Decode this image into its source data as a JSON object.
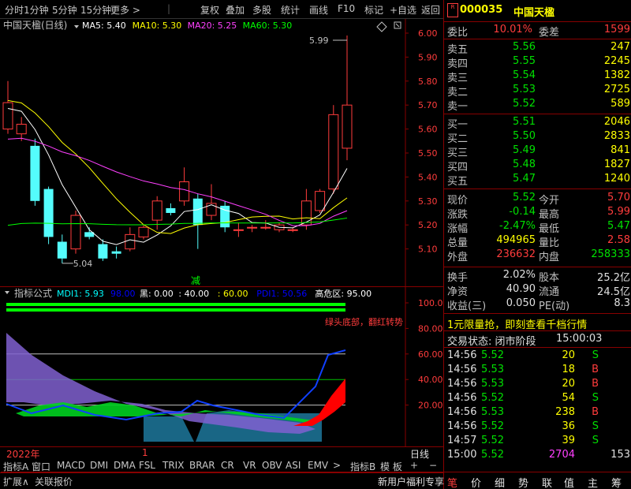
{
  "toolbar": {
    "items": [
      "分时",
      "1分钟",
      "5分钟",
      "15分钟",
      "更多 >",
      "复权",
      "叠加",
      "多股",
      "统计",
      "画线",
      "F10",
      "标记",
      "+自选",
      "返回"
    ]
  },
  "chart": {
    "title": "中国天楹(日线)",
    "ma_labels": [
      {
        "text": "MA5: 5.40",
        "color": "#ffffff"
      },
      {
        "text": "MA10: 5.30",
        "color": "#ffff00"
      },
      {
        "text": "MA20: 5.25",
        "color": "#ff40ff"
      },
      {
        "text": "MA60: 5.30",
        "color": "#00ff00"
      }
    ],
    "high_label": "5.99",
    "low_label": "5.04",
    "marker_text": "减",
    "y_ticks": [
      "6.00",
      "5.90",
      "5.80",
      "5.70",
      "5.60",
      "5.50",
      "5.40",
      "5.30",
      "5.20",
      "5.10"
    ],
    "candles": [
      {
        "o": 5.6,
        "c": 5.71,
        "h": 5.8,
        "l": 5.58
      },
      {
        "o": 5.58,
        "c": 5.62,
        "h": 5.65,
        "l": 5.55
      },
      {
        "o": 5.53,
        "c": 5.3,
        "h": 5.56,
        "l": 5.28
      },
      {
        "o": 5.35,
        "c": 5.15,
        "h": 5.36,
        "l": 5.12
      },
      {
        "o": 5.13,
        "c": 5.06,
        "h": 5.16,
        "l": 5.04
      },
      {
        "o": 5.1,
        "c": 5.24,
        "h": 5.26,
        "l": 5.08
      },
      {
        "o": 5.17,
        "c": 5.15,
        "h": 5.19,
        "l": 5.14
      },
      {
        "o": 5.12,
        "c": 5.06,
        "h": 5.14,
        "l": 5.05
      },
      {
        "o": 5.09,
        "c": 5.08,
        "h": 5.11,
        "l": 5.06
      },
      {
        "o": 5.1,
        "c": 5.16,
        "h": 5.19,
        "l": 5.09
      },
      {
        "o": 5.15,
        "c": 5.19,
        "h": 5.2,
        "l": 5.14
      },
      {
        "o": 5.22,
        "c": 5.3,
        "h": 5.32,
        "l": 5.18
      },
      {
        "o": 5.27,
        "c": 5.25,
        "h": 5.29,
        "l": 5.24
      },
      {
        "o": 5.3,
        "c": 5.38,
        "h": 5.44,
        "l": 5.28
      },
      {
        "o": 5.31,
        "c": 5.2,
        "h": 5.33,
        "l": 5.1
      },
      {
        "o": 5.24,
        "c": 5.29,
        "h": 5.37,
        "l": 5.22
      },
      {
        "o": 5.28,
        "c": 5.19,
        "h": 5.3,
        "l": 5.17
      },
      {
        "o": 5.18,
        "c": 5.18,
        "h": 5.21,
        "l": 5.15
      },
      {
        "o": 5.19,
        "c": 5.19,
        "h": 5.2,
        "l": 5.17
      },
      {
        "o": 5.19,
        "c": 5.19,
        "h": 5.22,
        "l": 5.18
      },
      {
        "o": 5.18,
        "c": 5.2,
        "h": 5.21,
        "l": 5.17
      },
      {
        "o": 5.18,
        "c": 5.18,
        "h": 5.19,
        "l": 5.17
      },
      {
        "o": 5.2,
        "c": 5.3,
        "h": 5.35,
        "l": 5.18
      },
      {
        "o": 5.26,
        "c": 5.34,
        "h": 5.35,
        "l": 5.25
      },
      {
        "o": 5.35,
        "c": 5.66,
        "h": 5.7,
        "l": 5.33
      },
      {
        "o": 5.52,
        "c": 5.7,
        "h": 5.99,
        "l": 5.47
      }
    ]
  },
  "indicator": {
    "title": "指标公式",
    "labels": [
      {
        "text": "MDI1: 5.93",
        "color": "#00ffff"
      },
      {
        "text": "98.00",
        "color": "#0000ff"
      },
      {
        "text": "黑: 0.00",
        "color": "#ffffff"
      },
      {
        "text": ": 40.00",
        "color": "#ffffff"
      },
      {
        "text": ": 60.00",
        "color": "#ffff00"
      },
      {
        "text": "PDI1: 50.56",
        "color": "#0000ff"
      },
      {
        "text": "高危区: 95.00",
        "color": "#ffffff"
      }
    ],
    "signal_text": "绿头底部，翻红转势",
    "y_ticks": [
      "100.0",
      "80.00",
      "60.00",
      "40.00",
      "20.00"
    ]
  },
  "bottom": {
    "year_label": "2022年",
    "date_label": "1",
    "period_label": "日线",
    "tabs": [
      "指标A",
      "窗口",
      "MACD",
      "DMI",
      "DMA",
      "FSL",
      "TRIX",
      "BRAR",
      "CR",
      "VR",
      "OBV",
      "ASI",
      "EMV",
      ">"
    ],
    "right_tabs": [
      "指标B",
      "模 板",
      "+",
      "−"
    ],
    "footer_left": [
      "扩展∧",
      "关联报价"
    ]
  },
  "quote": {
    "code": "000035",
    "name": "中国天楹",
    "weibi_label": "委比",
    "weibi_value": "10.01%",
    "weicha_label": "委差",
    "weicha_value": "1599",
    "asks": [
      {
        "label": "卖五",
        "price": "5.56",
        "vol": "247"
      },
      {
        "label": "卖四",
        "price": "5.55",
        "vol": "2245"
      },
      {
        "label": "卖三",
        "price": "5.54",
        "vol": "1382"
      },
      {
        "label": "卖二",
        "price": "5.53",
        "vol": "2725"
      },
      {
        "label": "卖一",
        "price": "5.52",
        "vol": "589"
      }
    ],
    "bids": [
      {
        "label": "买一",
        "price": "5.51",
        "vol": "2046"
      },
      {
        "label": "买二",
        "price": "5.50",
        "vol": "2833"
      },
      {
        "label": "买三",
        "price": "5.49",
        "vol": "841"
      },
      {
        "label": "买四",
        "price": "5.48",
        "vol": "1827"
      },
      {
        "label": "买五",
        "price": "5.47",
        "vol": "1240"
      }
    ],
    "stats": [
      {
        "l1": "现价",
        "v1": "5.52",
        "c1": "green",
        "l2": "今开",
        "v2": "5.70",
        "c2": "red"
      },
      {
        "l1": "涨跌",
        "v1": "-0.14",
        "c1": "green",
        "l2": "最高",
        "v2": "5.99",
        "c2": "red"
      },
      {
        "l1": "涨幅",
        "v1": "-2.47%",
        "c1": "green",
        "l2": "最低",
        "v2": "5.47",
        "c2": "green"
      },
      {
        "l1": "总量",
        "v1": "494965",
        "c1": "yellow",
        "l2": "量比",
        "v2": "2.58",
        "c2": "red"
      },
      {
        "l1": "外盘",
        "v1": "236632",
        "c1": "red",
        "l2": "内盘",
        "v2": "258333",
        "c2": "green"
      }
    ],
    "fin": [
      {
        "l1": "换手",
        "v1": "2.02%",
        "l2": "股本",
        "v2": "25.2亿"
      },
      {
        "l1": "净资",
        "v1": "40.90",
        "l2": "流通",
        "v2": "24.5亿"
      },
      {
        "l1": "收益(三)",
        "v1": "0.050",
        "l2": "PE(动)",
        "v2": "8.3"
      }
    ],
    "promo": "1元限量抢，即刻查看千档行情",
    "status_label": "交易状态: 闭市阶段",
    "status_time": "15:00:03",
    "trades": [
      {
        "t": "14:56",
        "p": "5.52",
        "v": "20",
        "s": "S"
      },
      {
        "t": "14:56",
        "p": "5.53",
        "v": "18",
        "s": "B"
      },
      {
        "t": "14:56",
        "p": "5.53",
        "v": "20",
        "s": "B"
      },
      {
        "t": "14:56",
        "p": "5.52",
        "v": "54",
        "s": "S"
      },
      {
        "t": "14:56",
        "p": "5.53",
        "v": "238",
        "s": "B"
      },
      {
        "t": "14:56",
        "p": "5.52",
        "v": "36",
        "s": "S"
      },
      {
        "t": "14:57",
        "p": "5.52",
        "v": "39",
        "s": "S"
      },
      {
        "t": "15:00",
        "p": "5.52",
        "v": "2704",
        "s": "153"
      }
    ],
    "footer_promo": "新用户福利专享",
    "footer_tabs": [
      "笔",
      "价",
      "细",
      "势",
      "联",
      "值",
      "主",
      "筹"
    ]
  }
}
